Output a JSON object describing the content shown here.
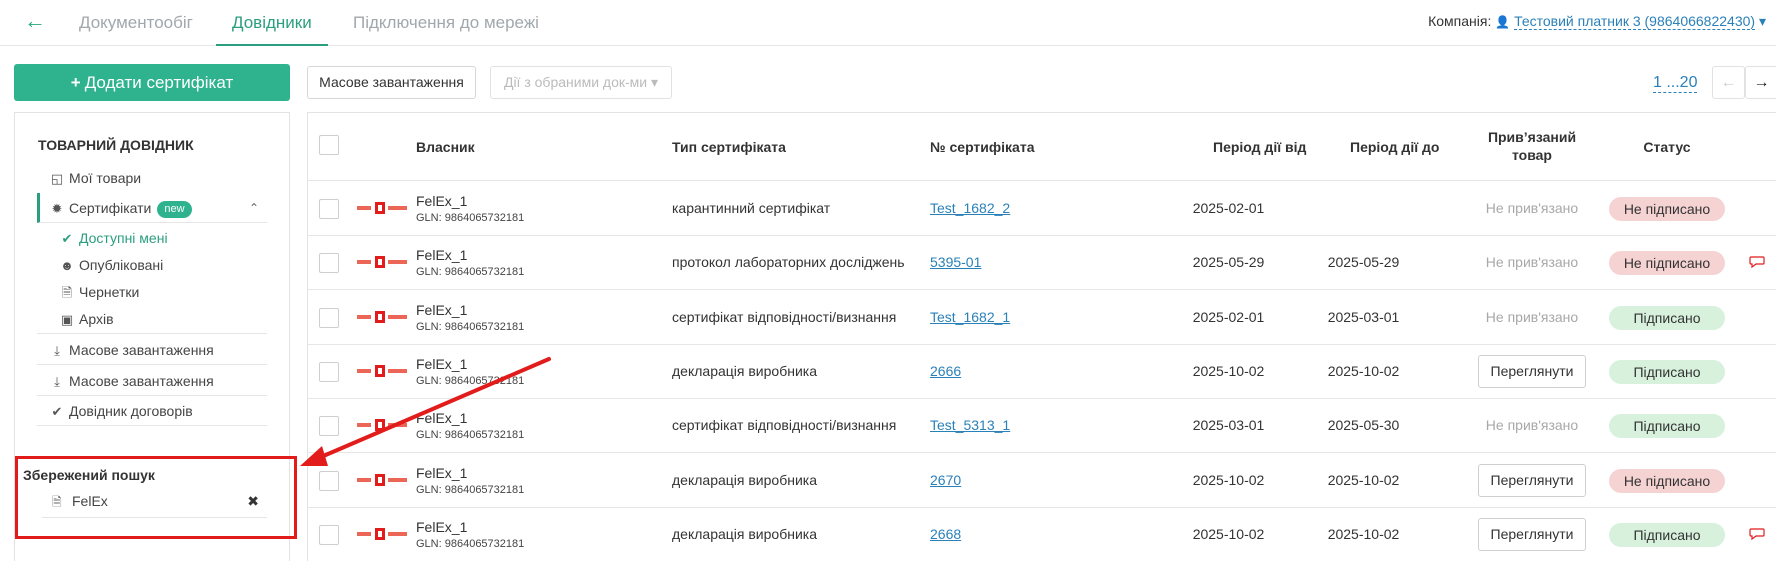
{
  "header": {
    "back_icon": "arrow-left-icon",
    "tabs": [
      {
        "label": "Документообіг"
      },
      {
        "label": "Довідники"
      },
      {
        "label": "Підключення до мережі"
      }
    ],
    "company_label": "Компанія:",
    "company_name": "Тестовий платник 3 (9864066822430)"
  },
  "sidebar": {
    "add_button": "Додати сертифікат",
    "section_title": "ТОВАРНИЙ ДОВІДНИК",
    "items": [
      {
        "label": "Мої товари",
        "icon": "cube-icon"
      },
      {
        "label": "Сертифікати",
        "icon": "gear-badge-icon",
        "badge": "new"
      },
      {
        "label": "Доступні мені",
        "icon": "check-circle-icon"
      },
      {
        "label": "Опубліковані",
        "icon": "users-icon"
      },
      {
        "label": "Чернетки",
        "icon": "file-icon"
      },
      {
        "label": "Архів",
        "icon": "archive-icon"
      },
      {
        "label": "Масове завантаження",
        "icon": "download-icon"
      },
      {
        "label": "Масове завантаження",
        "icon": "download-icon"
      },
      {
        "label": "Довідник договорів",
        "icon": "check-icon"
      }
    ],
    "saved_search_title": "Збережений пошук",
    "saved_searches": [
      {
        "label": "FelEx",
        "icon": "file-icon"
      }
    ]
  },
  "toolbar": {
    "bulk_upload": "Масове завантаження",
    "with_selected": "Дії з обраними док-ми",
    "pager": "1 ...20"
  },
  "table": {
    "columns": {
      "owner": "Власник",
      "type": "Тип сертифіката",
      "number": "№ сертифіката",
      "from": "Період дії від",
      "to": "Період дії до",
      "linked": "Прив’язаний товар",
      "status": "Статус"
    },
    "view_label": "Переглянути",
    "rows": [
      {
        "owner": "FelEx_1",
        "gln": "GLN: 9864065732181",
        "type": "карантинний сертифікат",
        "number": "Test_1682_2",
        "from": "2025-02-01",
        "to": "",
        "linked": "Не прив'язано",
        "status": "Не підписано",
        "status_kind": "neg",
        "comment": false
      },
      {
        "owner": "FelEx_1",
        "gln": "GLN: 9864065732181",
        "type": "протокол лабораторних досліджень",
        "number": "5395-01",
        "from": "2025-05-29",
        "to": "2025-05-29",
        "linked": "Не прив'язано",
        "status": "Не підписано",
        "status_kind": "neg",
        "comment": true
      },
      {
        "owner": "FelEx_1",
        "gln": "GLN: 9864065732181",
        "type": "сертифікат відповідності/визнання",
        "number": "Test_1682_1",
        "from": "2025-02-01",
        "to": "2025-03-01",
        "linked": "Не прив'язано",
        "status": "Підписано",
        "status_kind": "pos",
        "comment": false
      },
      {
        "owner": "FelEx_1",
        "gln": "GLN: 9864065732181",
        "type": "декларація виробника",
        "number": "2666",
        "from": "2025-10-02",
        "to": "2025-10-02",
        "linked": "view",
        "status": "Підписано",
        "status_kind": "pos",
        "comment": false
      },
      {
        "owner": "FelEx_1",
        "gln": "GLN: 9864065732181",
        "type": "сертифікат відповідності/визнання",
        "number": "Test_5313_1",
        "from": "2025-03-01",
        "to": "2025-05-30",
        "linked": "Не прив'язано",
        "status": "Підписано",
        "status_kind": "pos",
        "comment": false
      },
      {
        "owner": "FelEx_1",
        "gln": "GLN: 9864065732181",
        "type": "декларація виробника",
        "number": "2670",
        "from": "2025-10-02",
        "to": "2025-10-02",
        "linked": "view",
        "status": "Не підписано",
        "status_kind": "neg",
        "comment": false
      },
      {
        "owner": "FelEx_1",
        "gln": "GLN: 9864065732181",
        "type": "декларація виробника",
        "number": "2668",
        "from": "2025-10-02",
        "to": "2025-10-02",
        "linked": "view",
        "status": "Підписано",
        "status_kind": "pos",
        "comment": true
      }
    ]
  },
  "colors": {
    "accent": "#2fb38f",
    "link": "#2a80b9",
    "annotation": "#e21b1b",
    "status_negative": "#f6d3d3",
    "status_positive": "#d7f1dd"
  }
}
